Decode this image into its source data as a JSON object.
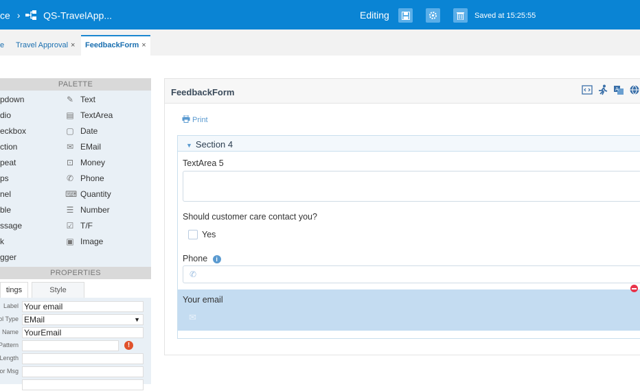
{
  "topbar": {
    "breadcrumb_prefix": "ce",
    "separator": "›",
    "app_name": "QS-TravelApp...",
    "editing": "Editing",
    "saved": "Saved at 15:25:55"
  },
  "tabs": [
    {
      "label": "e"
    },
    {
      "label": "Travel Approval",
      "close": "×"
    },
    {
      "label": "FeedbackForm",
      "close": "×"
    }
  ],
  "palette": {
    "title": "PALETTE",
    "left_items": [
      "pdown",
      "dio",
      "eckbox",
      "ction",
      "peat",
      "ps",
      "nel",
      "ble",
      "ssage",
      "k",
      "gger"
    ],
    "right_items": [
      "Text",
      "TextArea",
      "Date",
      "EMail",
      "Money",
      "Phone",
      "Quantity",
      "Number",
      "T/F",
      "Image"
    ]
  },
  "properties": {
    "title": "PROPERTIES",
    "tabs": [
      "tings",
      "Style"
    ],
    "rows": [
      {
        "label": "Label",
        "value": "Your email"
      },
      {
        "label": "ol Type",
        "value": "EMail"
      },
      {
        "label": "Name",
        "value": "YourEmail"
      },
      {
        "label": "Pattern",
        "value": ""
      },
      {
        "label": "Length",
        "value": ""
      },
      {
        "label": "or Msg",
        "value": ""
      },
      {
        "label": "",
        "value": ""
      }
    ],
    "select_arrow": "▼"
  },
  "form": {
    "title": "FeedbackForm",
    "print": "Print",
    "section": "Section 4",
    "textarea_label": "TextArea 5",
    "question": "Should customer care contact you?",
    "checkbox_label": "Yes",
    "phone_label": "Phone",
    "email_label": "Your email"
  },
  "colors": {
    "topbar": "#0a84d4",
    "accent": "#1a86d0",
    "highlight": "#c4dcf1",
    "remove": "#e8334a"
  }
}
